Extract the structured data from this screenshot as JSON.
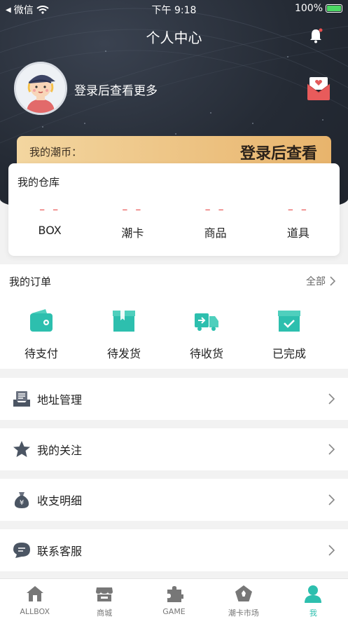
{
  "status_bar": {
    "carrier": "微信",
    "time": "下午 9:18",
    "battery": "100%"
  },
  "header": {
    "title": "个人中心"
  },
  "profile": {
    "login_tip": "登录后查看更多"
  },
  "coins": {
    "label": "我的潮币：",
    "value": "登录后查看"
  },
  "warehouse": {
    "title": "我的仓库",
    "items": [
      {
        "value": "– –",
        "label": "BOX"
      },
      {
        "value": "– –",
        "label": "潮卡"
      },
      {
        "value": "– –",
        "label": "商品"
      },
      {
        "value": "– –",
        "label": "道具"
      }
    ]
  },
  "orders": {
    "title": "我的订单",
    "all_label": "全部",
    "items": [
      {
        "label": "待支付",
        "icon": "wallet-icon"
      },
      {
        "label": "待发货",
        "icon": "box-icon"
      },
      {
        "label": "待收货",
        "icon": "truck-icon"
      },
      {
        "label": "已完成",
        "icon": "completed-box-icon"
      }
    ]
  },
  "menu": [
    {
      "label": "地址管理",
      "icon": "address-icon"
    },
    {
      "label": "我的关注",
      "icon": "star-icon"
    },
    {
      "label": "收支明细",
      "icon": "money-bag-icon"
    },
    {
      "label": "联系客服",
      "icon": "chat-icon"
    }
  ],
  "tabbar": [
    {
      "label": "ALLBOX",
      "icon": "home-icon"
    },
    {
      "label": "商城",
      "icon": "shop-icon"
    },
    {
      "label": "GAME",
      "icon": "puzzle-icon"
    },
    {
      "label": "潮卡市场",
      "icon": "market-icon"
    },
    {
      "label": "我",
      "icon": "person-icon",
      "active": true
    }
  ],
  "colors": {
    "accent": "#2dbfae",
    "dash_red": "#e8504f",
    "hero_bg": "#252b35",
    "coin_gold": "#e8b46c"
  }
}
